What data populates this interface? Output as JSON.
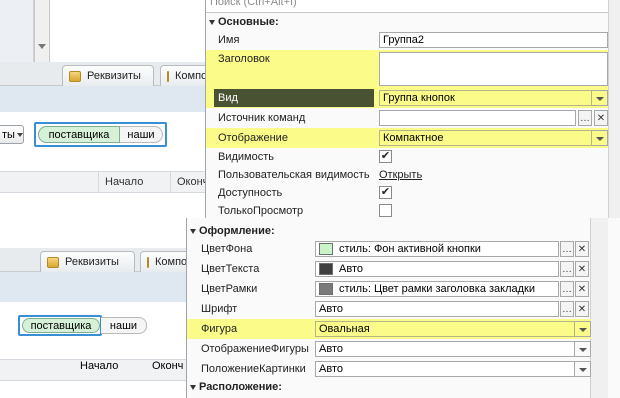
{
  "top_left": {
    "tabs": [
      {
        "label": "Реквизиты"
      },
      {
        "label": "Компоновка"
      }
    ],
    "dropdown_label": "ты",
    "button_group": {
      "left": "поставщика",
      "right": "наши"
    },
    "grid_columns": [
      "Начало",
      "Оконч"
    ]
  },
  "bottom_left": {
    "tabs": [
      {
        "label": "Реквизиты"
      },
      {
        "label": "Компоновка"
      }
    ],
    "button_group": {
      "left": "поставщика",
      "right": "наши"
    },
    "grid_columns": [
      "Начало",
      "Оконч"
    ]
  },
  "props_top": {
    "search_placeholder": "Поиск (Ctrl+Alt+I)",
    "category": "Основные:",
    "rows": {
      "name": {
        "label": "Имя",
        "value": "Группа2"
      },
      "title": {
        "label": "Заголовок",
        "value": ""
      },
      "kind": {
        "label": "Вид",
        "value": "Группа кнопок"
      },
      "command_source": {
        "label": "Источник команд",
        "value": ""
      },
      "display": {
        "label": "Отображение",
        "value": "Компактное"
      },
      "visibility": {
        "label": "Видимость",
        "checked": "✔"
      },
      "user_visibility": {
        "label": "Пользовательская видимость",
        "link": "Открыть"
      },
      "availability": {
        "label": "Доступность",
        "checked": "✔"
      },
      "readonly": {
        "label": "ТолькоПросмотр",
        "checked": ""
      }
    }
  },
  "props_bottom": {
    "category": "Оформление:",
    "category_next": "Расположение:",
    "rows": {
      "back_color": {
        "label": "ЦветФона",
        "value": "стиль: Фон активной кнопки",
        "swatch": "#c9f5c9"
      },
      "text_color": {
        "label": "ЦветТекста",
        "value": "Авто",
        "swatch": "#404040"
      },
      "border_color": {
        "label": "ЦветРамки",
        "value": "стиль: Цвет рамки заголовка закладки",
        "swatch": "#7a7a7a"
      },
      "font": {
        "label": "Шрифт",
        "value": "Авто"
      },
      "shape": {
        "label": "Фигура",
        "value": "Овальная"
      },
      "shape_display": {
        "label": "ОтображениеФигуры",
        "value": "Авто"
      },
      "picture_position": {
        "label": "ПоложениеКартинки",
        "value": "Авто"
      }
    }
  },
  "colors": {
    "highlight": "#fbfb8a",
    "selection_border": "#3a8fd4",
    "active_pill": "#d7f1d8"
  },
  "icons": [
    "chevron-down-icon",
    "ellipsis-icon",
    "clear-x-icon",
    "checkbox-icon",
    "tab-layout-icon"
  ]
}
